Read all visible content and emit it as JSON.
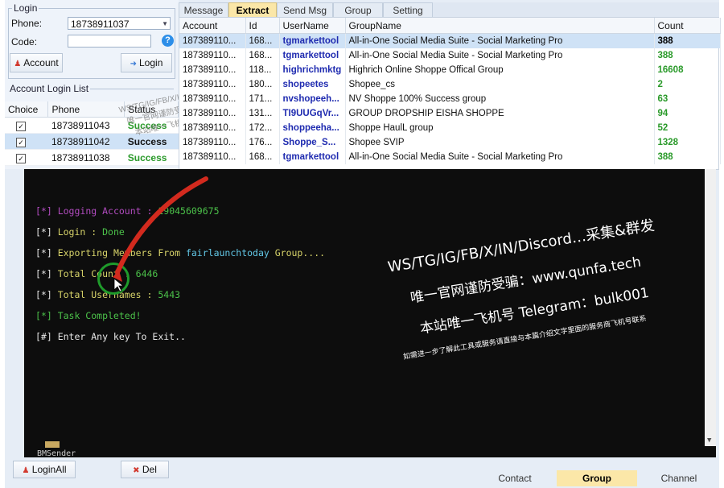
{
  "login": {
    "legend": "Login",
    "phone_label": "Phone:",
    "phone_value": "18738911037",
    "code_label": "Code:",
    "code_value": "",
    "help_glyph": "?",
    "account_button": "Account",
    "login_button": "Login"
  },
  "account_list": {
    "title": "Account Login List",
    "columns": [
      "Choice",
      "Phone",
      "Status"
    ],
    "rows": [
      {
        "checked": "✓",
        "phone": "18738911043",
        "status": "Success"
      },
      {
        "checked": "✓",
        "phone": "18738911042",
        "status": "Success"
      },
      {
        "checked": "✓",
        "phone": "18738911038",
        "status": "Success"
      }
    ]
  },
  "tabs": [
    "Message",
    "Extract",
    "Send Msg",
    "Group",
    "Setting"
  ],
  "active_tab": "Extract",
  "grid": {
    "columns": [
      "Account",
      "Id",
      "UserName",
      "GroupName",
      "Count"
    ],
    "rows": [
      {
        "account": "187389110...",
        "id": "168...",
        "username": "tgmarkettool",
        "group": "All-in-One Social Media Suite - Social Marketing Pro",
        "count": "388"
      },
      {
        "account": "187389110...",
        "id": "168...",
        "username": "tgmarkettool",
        "group": "All-in-One Social Media Suite - Social Marketing Pro",
        "count": "388"
      },
      {
        "account": "187389110...",
        "id": "118...",
        "username": "highrichmktg",
        "group": "Highrich Online Shoppe Offical Group",
        "count": "16608"
      },
      {
        "account": "187389110...",
        "id": "180...",
        "username": "shopeetes",
        "group": "Shopee_cs",
        "count": "2"
      },
      {
        "account": "187389110...",
        "id": "171...",
        "username": "nvshopeeh...",
        "group": "NV Shoppe 100% Success group",
        "count": "63"
      },
      {
        "account": "187389110...",
        "id": "131...",
        "username": "TI9UUGqVr...",
        "group": "GROUP DROPSHIP EISHA SHOPPE",
        "count": "94"
      },
      {
        "account": "187389110...",
        "id": "172...",
        "username": "shoppeeha...",
        "group": "Shoppe HaulL group",
        "count": "52"
      },
      {
        "account": "187389110...",
        "id": "176...",
        "username": "Shoppe_S...",
        "group": "Shopee SVIP",
        "count": "1328"
      },
      {
        "account": "187389110...",
        "id": "168...",
        "username": "tgmarkettool",
        "group": "All-in-One Social Media Suite - Social Marketing Pro",
        "count": "388"
      }
    ]
  },
  "console": {
    "l1_tag": "[*]",
    "l1_text": " Logging Account : ",
    "l1_value": "19045609675",
    "l2_tag": "[*]",
    "l2_text": " Login : ",
    "l2_value": "Done",
    "l3_tag": "[*]",
    "l3_text": " Exporting Members From ",
    "l3_value": "fairlaunchtoday",
    "l3_tail": " Group....",
    "l4_tag": "[*]",
    "l4_text": " Total Count : ",
    "l4_value": "6446",
    "l5_tag": "[*]",
    "l5_text": " Total Usernames : ",
    "l5_value": "5443",
    "l6_text": "[*] Task Completed!",
    "l7_text": "[#] Enter Any key To Exit..",
    "caption": "BMSender"
  },
  "watermark": {
    "line1": "WS/TG/IG/FB/X/IN/Discord…采集&群发",
    "line2": "唯一官网谨防受骗：www.qunfa.tech",
    "line3": "本站唯一飞机号 Telegram：bulk001",
    "line4": "如需进一步了解此工具或服务请直接与本篇介绍文字里面的服务商飞机号联系",
    "small1": "WS/TG/IG/FB/X/IN/Discord…采集&群发",
    "small2": "唯一官网谨防受骗：www.qunfa.tech",
    "small3": "本站唯一飞机号 Telegram：bulk001"
  },
  "bottom": {
    "login_all": "LoginAll",
    "del": "Del",
    "tabs": [
      "Contact",
      "Group",
      "Channel"
    ],
    "active_tab": "Group"
  },
  "colors": {
    "accent_tab": "#fbe7a8",
    "success": "#2a9a2a",
    "selection": "#cfe2f6",
    "console_bg": "#0d0d0d",
    "annotation_red": "#d22a1e",
    "annotation_green": "#1f9b2b"
  }
}
